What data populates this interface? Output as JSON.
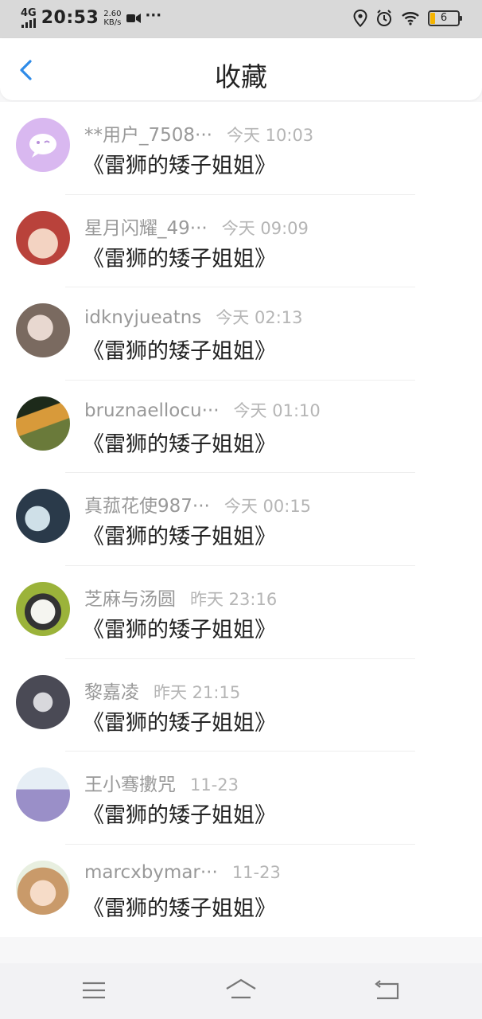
{
  "status_bar": {
    "network": "4G",
    "time": "20:53",
    "speed_value": "2.60",
    "speed_unit": "KB/s",
    "more": "···",
    "battery": "6"
  },
  "header": {
    "title": "收藏",
    "back_icon": "chevron-left-icon"
  },
  "items": [
    {
      "user": "**用户_7508···",
      "time": "今天 10:03",
      "title": "《雷狮的矮子姐姐》",
      "avatar_color": "#d9b8f0"
    },
    {
      "user": "星月闪耀_49···",
      "time": "今天 09:09",
      "title": "《雷狮的矮子姐姐》",
      "avatar_color": "#b9423b"
    },
    {
      "user": "idknyjueatns",
      "time": "今天 02:13",
      "title": "《雷狮的矮子姐姐》",
      "avatar_color": "#7a6a60"
    },
    {
      "user": "bruznaellocu···",
      "time": "今天 01:10",
      "title": "《雷狮的矮子姐姐》",
      "avatar_color": "#6a7a3a"
    },
    {
      "user": "真菰花使987···",
      "time": "今天 00:15",
      "title": "《雷狮的矮子姐姐》",
      "avatar_color": "#2a3a4a"
    },
    {
      "user": "芝麻与汤圆",
      "time": "昨天 23:16",
      "title": "《雷狮的矮子姐姐》",
      "avatar_color": "#9bb33a"
    },
    {
      "user": "黎嘉凌",
      "time": "昨天 21:15",
      "title": "《雷狮的矮子姐姐》",
      "avatar_color": "#4a4a55"
    },
    {
      "user": "王小骞擻咒",
      "time": "11-23",
      "title": "《雷狮的矮子姐姐》",
      "avatar_color": "#9a8fc8"
    },
    {
      "user": "marcxbymar···",
      "time": "11-23",
      "title": "《雷狮的矮子姐姐》",
      "avatar_color": "#c99a6a"
    }
  ],
  "nav": {
    "menu_icon": "menu-icon",
    "home_icon": "home-icon",
    "back_icon": "back-icon"
  },
  "colors": {
    "accent": "#2e8be8",
    "username": "#999999",
    "time": "#b5b5b5",
    "title": "#222222"
  }
}
